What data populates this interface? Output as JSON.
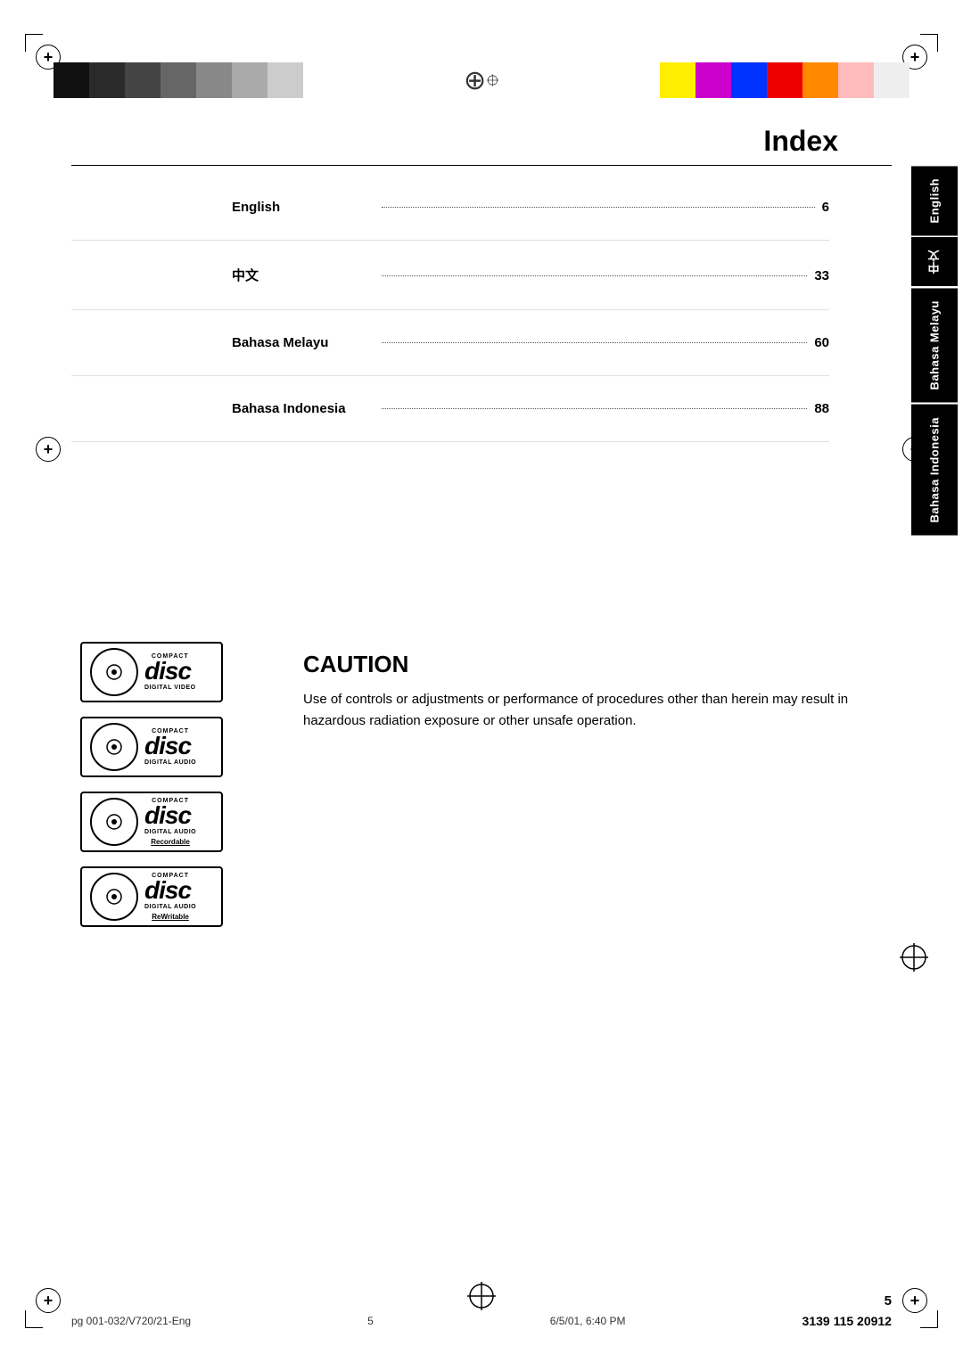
{
  "page": {
    "title": "Index",
    "page_number": "5"
  },
  "color_bars": {
    "left": [
      "#1a1a1a",
      "#555555",
      "#888888",
      "#aaaaaa",
      "#cccccc",
      "#dddddd",
      "#eeeeee"
    ],
    "right": [
      "#ffff00",
      "#aa00aa",
      "#0000ff",
      "#ff0000",
      "#ff9900",
      "#ffcccc",
      "#ffffff"
    ]
  },
  "index_entries": [
    {
      "label": "English",
      "dots": true,
      "page": "6"
    },
    {
      "label": "中文",
      "dots": true,
      "page": "33"
    },
    {
      "label": "Bahasa Melayu",
      "dots": true,
      "page": "60"
    },
    {
      "label": "Bahasa Indonesia",
      "dots": true,
      "page": "88"
    }
  ],
  "side_tabs": [
    {
      "label": "English"
    },
    {
      "label": "中文"
    },
    {
      "label": "Bahasa Melayu"
    },
    {
      "label": "Bahasa Indonesia"
    }
  ],
  "disc_logos": [
    {
      "compact": "COMPACT",
      "letters": "disc",
      "subtitle": "DIGITAL VIDEO",
      "extra": ""
    },
    {
      "compact": "COMPACT",
      "letters": "disc",
      "subtitle": "DIGITAL AUDIO",
      "extra": ""
    },
    {
      "compact": "COMPACT",
      "letters": "disc",
      "subtitle": "DIGITAL AUDIO",
      "extra": "Recordable"
    },
    {
      "compact": "COMPACT",
      "letters": "disc",
      "subtitle": "DIGITAL AUDIO",
      "extra": "ReWritable"
    }
  ],
  "caution": {
    "title": "CAUTION",
    "text": "Use of controls or adjustments or performance of procedures other than herein may result in hazardous radiation exposure or other unsafe operation."
  },
  "footer": {
    "left": "pg 001-032/V720/21-Eng",
    "center": "5",
    "right": "3139 115 20912",
    "date": "6/5/01, 6:40 PM"
  }
}
